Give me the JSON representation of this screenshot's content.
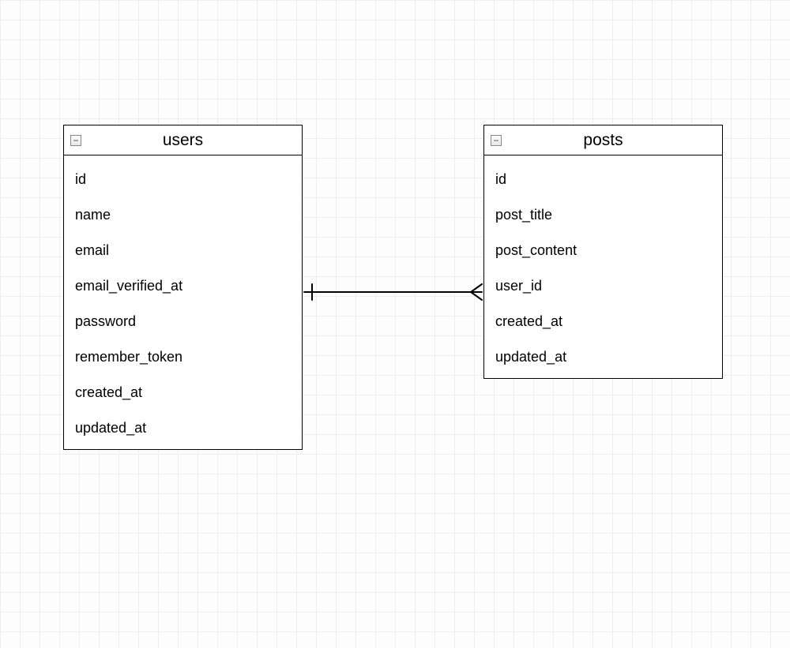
{
  "entities": {
    "users": {
      "title": "users",
      "collapse_symbol": "−",
      "fields": [
        "id",
        "name",
        "email",
        "email_verified_at",
        "password",
        "remember_token",
        "created_at",
        "updated_at"
      ]
    },
    "posts": {
      "title": "posts",
      "collapse_symbol": "−",
      "fields": [
        "id",
        "post_title",
        "post_content",
        "user_id",
        "created_at",
        "updated_at"
      ]
    }
  },
  "relationship": {
    "from": "users",
    "to": "posts",
    "type": "one-to-many"
  }
}
